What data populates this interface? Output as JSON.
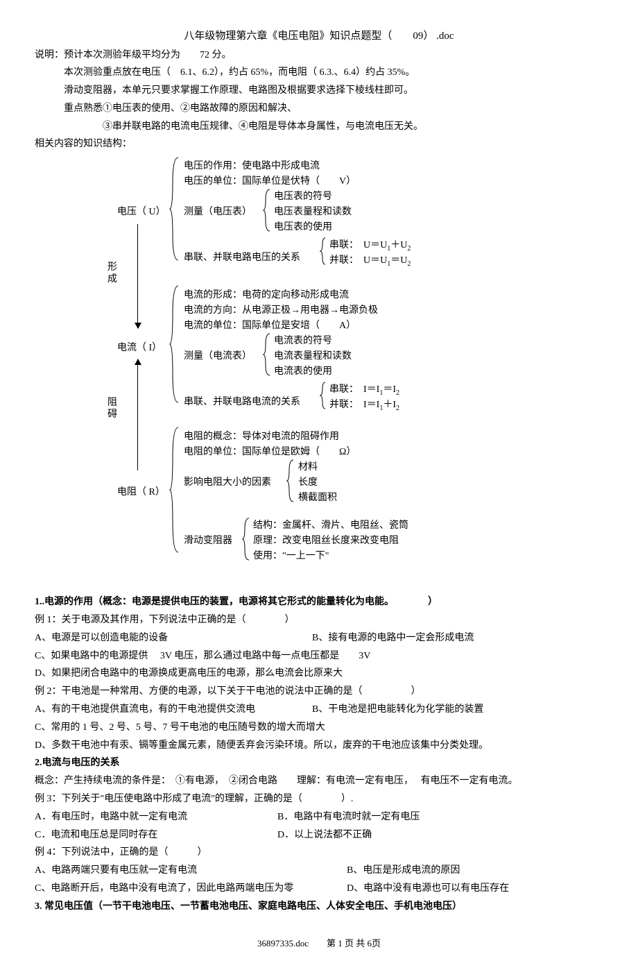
{
  "title": "八年级物理第六章《电压电阻》知识点题型（　　09） .doc",
  "intro": {
    "l1": "说明：预计本次测验年级平均分为　　72 分。",
    "l2": "本次测验重点放在电压（　6.1、6.2），约占 65%，而电阻（ 6.3.、6.4）约占 35%。",
    "l3": "滑动变阻器，本单元只要求掌握工作原理、电路图及根据要求选择下棱线柱即可。",
    "l4": "重点熟悉①电压表的使用、②电路故障的原因和解决、",
    "l5": "③串并联电路的电流电压规律、④电阻是导体本身属性，与电流电压无关。",
    "l6": "相关内容的知识结构："
  },
  "diagram": {
    "u_label": "电压（ U）",
    "u_d1": "电压的作用：使电路中形成电流",
    "u_d2": "电压的单位：国际单位是伏特（　　V）",
    "u_d3": "测量（电压表）",
    "u_m1": "电压表的符号",
    "u_m2": "电压表量程和读数",
    "u_m3": "电压表的使用",
    "u_d4": "串联、并联电路电压的关系",
    "u_r1": "串联：　U＝U",
    "u_r1b": "＋U",
    "u_r2": "并联：　U＝U",
    "u_r2b": "＝U",
    "form": "形成",
    "i_label": "电流（ I）",
    "i_d1": "电流的形成：电荷的定向移动形成电流",
    "i_d2": "电流的方向：从电源正极→用电器→电源负极",
    "i_d3": "电流的单位：国际单位是安培（　　A）",
    "i_d4": "测量（电流表）",
    "i_m1": "电流表的符号",
    "i_m2": "电流表量程和读数",
    "i_m3": "电流表的使用",
    "i_d5": "串联、并联电路电流的关系",
    "i_r1": "串联：　I＝I",
    "i_r1b": "＝I",
    "i_r2": "并联：　I＝I",
    "i_r2b": "＋I",
    "block": "阻碍",
    "r_label": "电阻（ R）",
    "r_d1": "电阻的概念：导体对电流的阻碍作用",
    "r_d2": "电阻的单位：国际单位是欧姆（　　Ω）",
    "r_d3": "影响电阻大小的因素",
    "r_f1": "材料",
    "r_f2": "长度",
    "r_f3": "横截面积",
    "r_d4": "滑动变阻器",
    "r_s1": "结构：金属杆、滑片、电阻丝、瓷筒",
    "r_s2": "原理：改变电阻丝长度来改变电阻",
    "r_s3": "使用：\"一上一下\""
  },
  "q1": {
    "head": "1..电源的作用（概念：电源是提供电压的装置，电源将其它形式的能量转化为电能。　　　　）",
    "ex1": "例 1：关于电源及其作用，下列说法中正确的是（　　　　）",
    "a": "A、电源是可以创造电能的设备",
    "b": "B、接有电源的电路中一定会形成电流",
    "c": "C、如果电路中的电源提供　 3V 电压，那么通过电路中每一点电压都是　　3V",
    "d": "D、如果把闭合电路中的电源换成更高电压的电源，那么电流会比原来大",
    "ex2": "例 2：干电池是一种常用、方便的电源，以下关于干电池的说法中正确的是（　　　　　）",
    "a2": "A、有的干电池提供直流电，有的干电池提供交流电",
    "b2": "B、干电池是把电能转化为化学能的装置",
    "c2": "C、常用的 1 号、2 号、5 号、7 号干电池的电压随号数的增大而增大",
    "d2": "D、多数干电池中有汞、镉等重金属元素，随便丢弃会污染环境。所以，废弃的干电池应该集中分类处理。"
  },
  "q2": {
    "head": "2.电流与电压的关系",
    "concept": "概念：产生持续电流的条件是：　①有电源，　②闭合电路　　理解：有电流一定有电压，　 有电压不一定有电流。",
    "ex3": "例 3：下列关于\"电压使电路中形成了电流\"的理解，正确的是（　　　　）.",
    "a": "A．有电压时，电路中就一定有电流",
    "b": "B．电路中有电流时就一定有电压",
    "c": "C．电流和电压总是同时存在",
    "d": "D．以上说法都不正确",
    "ex4": "例 4：下列说法中，正确的是（　　　）",
    "a4": "A、电路两端只要有电压就一定有电流",
    "b4": "B、电压是形成电流的原因",
    "c4": "C、电路断开后，电路中没有电流了，因此电路两端电压为零",
    "d4": "D、电路中没有电源也可以有电压存在"
  },
  "q3": "3. 常见电压值（一节干电池电压、一节蓄电池电压、家庭电路电压、人体安全电压、手机电池电压）",
  "footer": "36897335.doc　　第 1 页 共 6页"
}
